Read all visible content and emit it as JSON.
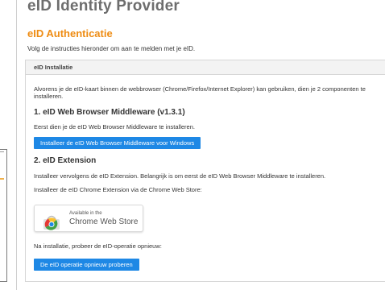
{
  "app": {
    "title": "eID Identity Provider"
  },
  "section": {
    "title": "eID Authenticatie",
    "instructions": "Volg de instructies hieronder om aan te melden met je eID."
  },
  "panel": {
    "header": "eID Installatie",
    "intro": "Alvorens je de eID-kaart binnen de webbrowser (Chrome/Firefox/Internet Explorer) kan gebruiken, dien je 2 componenten te installeren.",
    "step1": {
      "title": "1. eID Web Browser Middleware (v1.3.1)",
      "text": "Eerst dien je de eID Web Browser Middleware te installeren.",
      "button": "Installeer de eID Web Browser Middleware voor Windows"
    },
    "step2": {
      "title": "2. eID Extension",
      "text1": "Installeer vervolgens de eID Extension. Belangrijk is om eerst de eID Web Browser Middleware te installeren.",
      "text2": "Installeer de eID Chrome Extension via de Chrome Web Store:",
      "store_small": "Available in the",
      "store_big": "Chrome Web Store"
    },
    "retry": {
      "text": "Na installatie, probeer de eID-operatie opnieuw:",
      "button": "De eID operatie opnieuw proberen"
    }
  },
  "colors": {
    "accent": "#ee8c13",
    "button": "#1e88e5",
    "title": "#6d6d6d"
  },
  "icons": {
    "store": "chrome-web-store-icon"
  }
}
